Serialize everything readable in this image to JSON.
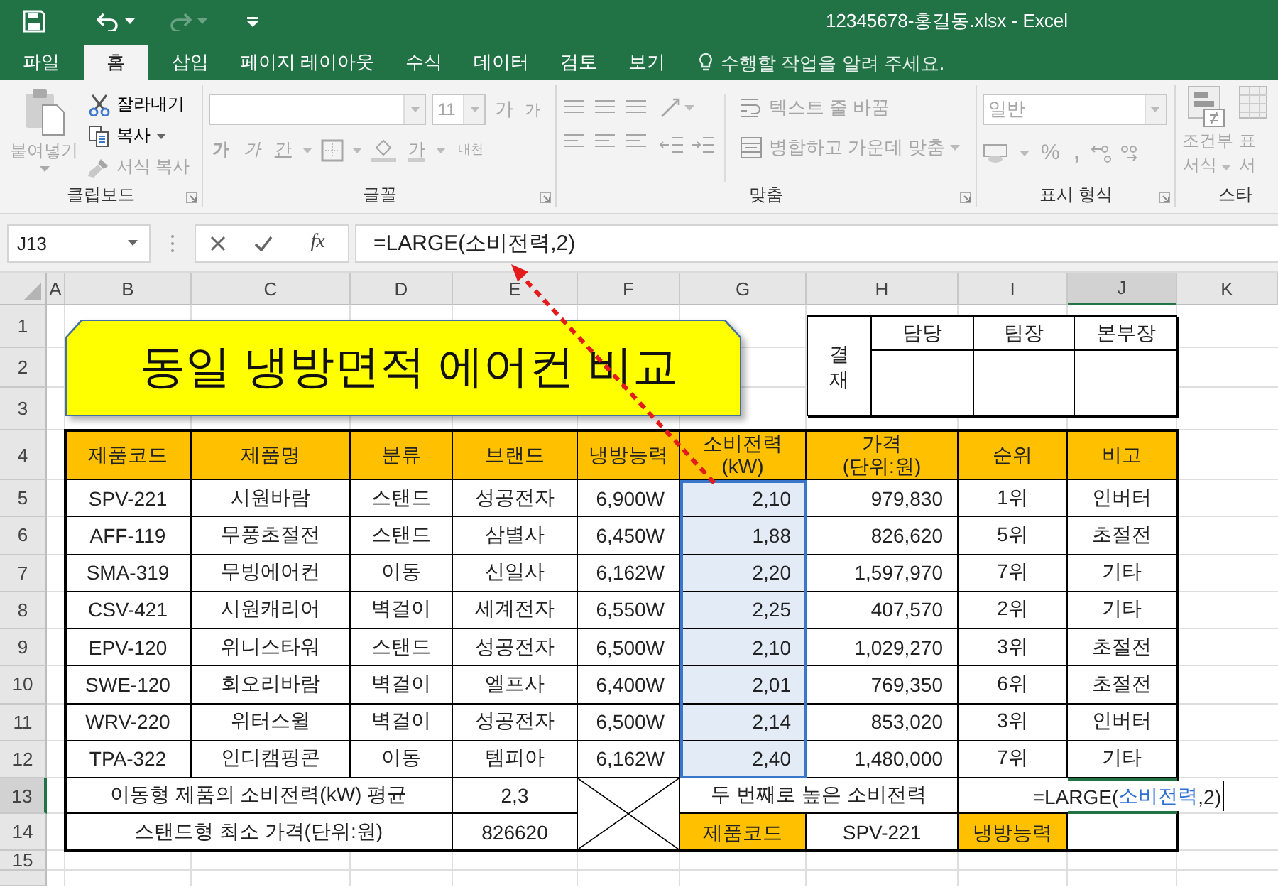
{
  "window": {
    "title": "12345678-홍길동.xlsx - Excel"
  },
  "tabs": [
    {
      "label": "파일",
      "selected": false
    },
    {
      "label": "홈",
      "selected": true
    },
    {
      "label": "삽입",
      "selected": false
    },
    {
      "label": "페이지 레이아웃",
      "selected": false
    },
    {
      "label": "수식",
      "selected": false
    },
    {
      "label": "데이터",
      "selected": false
    },
    {
      "label": "검토",
      "selected": false
    },
    {
      "label": "보기",
      "selected": false
    }
  ],
  "tell_me": {
    "placeholder": "수행할 작업을 알려 주세요."
  },
  "ribbon": {
    "clipboard": {
      "label": "클립보드",
      "paste": {
        "label": "붙여넣기",
        "disabled": true
      },
      "cut": {
        "label": "잘라내기",
        "disabled": false
      },
      "copy": {
        "label": "복사",
        "disabled": false
      },
      "format_painter": {
        "label": "서식 복사",
        "disabled": true
      }
    },
    "font": {
      "label": "글꼴",
      "disabled": true,
      "size": "11",
      "grow": "가",
      "shrink": "가",
      "bold": "가",
      "italic": "가",
      "underline": "간",
      "font_color": "가",
      "phonetic": "내천"
    },
    "alignment": {
      "label": "맞춤",
      "disabled": true,
      "wrap_text": "텍스트 줄 바꿈",
      "merge": "병합하고 가운데 맞춤"
    },
    "number": {
      "label": "표시 형식",
      "disabled": true,
      "format": "일반",
      "percent": "%",
      "comma": ","
    },
    "styles": {
      "label": "스타",
      "disabled": true,
      "conditional": [
        "조건부",
        "서식"
      ],
      "table": [
        "표",
        "서"
      ]
    }
  },
  "formula_bar": {
    "name_box": "J13",
    "function_label": "fx",
    "formula": "=LARGE(소비전력,2)"
  },
  "sheet": {
    "columns": [
      {
        "label": "A",
        "selected": false
      },
      {
        "label": "B",
        "selected": false
      },
      {
        "label": "C",
        "selected": false
      },
      {
        "label": "D",
        "selected": false
      },
      {
        "label": "E",
        "selected": false
      },
      {
        "label": "F",
        "selected": false
      },
      {
        "label": "G",
        "selected": false
      },
      {
        "label": "H",
        "selected": false
      },
      {
        "label": "I",
        "selected": false
      },
      {
        "label": "J",
        "selected": true
      },
      {
        "label": "K",
        "selected": false
      }
    ],
    "rows": [
      {
        "label": "1",
        "selected": false
      },
      {
        "label": "2",
        "selected": false
      },
      {
        "label": "3",
        "selected": false
      },
      {
        "label": "4",
        "selected": false
      },
      {
        "label": "5",
        "selected": false
      },
      {
        "label": "6",
        "selected": false
      },
      {
        "label": "7",
        "selected": false
      },
      {
        "label": "8",
        "selected": false
      },
      {
        "label": "9",
        "selected": false
      },
      {
        "label": "10",
        "selected": false
      },
      {
        "label": "11",
        "selected": false
      },
      {
        "label": "12",
        "selected": false
      },
      {
        "label": "13",
        "selected": true
      },
      {
        "label": "14",
        "selected": false
      },
      {
        "label": "15",
        "selected": false
      }
    ]
  },
  "title_banner": {
    "text": "동일 냉방면적 에어컨 비교"
  },
  "approval": {
    "label": "결재",
    "roles": [
      "담당",
      "팀장",
      "본부장"
    ]
  },
  "table": {
    "columns": [
      {
        "label": "제품코드",
        "highlighted": false
      },
      {
        "label": "제품명",
        "highlighted": false
      },
      {
        "label": "분류",
        "highlighted": false
      },
      {
        "label": "브랜드",
        "highlighted": false
      },
      {
        "label": "냉방능력",
        "highlighted": false
      },
      {
        "label": "소비전력\n(kW)",
        "highlighted": true
      },
      {
        "label": "가격\n(단위:원)",
        "highlighted": false
      },
      {
        "label": "순위",
        "highlighted": false
      },
      {
        "label": "비고",
        "highlighted": false
      }
    ],
    "rows": [
      [
        "SPV-221",
        "시원바람",
        "스탠드",
        "성공전자",
        "6,900W",
        "2,10",
        "979,830",
        "1위",
        "인버터"
      ],
      [
        "AFF-119",
        "무풍초절전",
        "스탠드",
        "삼별사",
        "6,450W",
        "1,88",
        "826,620",
        "5위",
        "초절전"
      ],
      [
        "SMA-319",
        "무빙에어컨",
        "이동",
        "신일사",
        "6,162W",
        "2,20",
        "1,597,970",
        "7위",
        "기타"
      ],
      [
        "CSV-421",
        "시원캐리어",
        "벽걸이",
        "세계전자",
        "6,550W",
        "2,25",
        "407,570",
        "2위",
        "기타"
      ],
      [
        "EPV-120",
        "위니스타워",
        "스탠드",
        "성공전자",
        "6,500W",
        "2,10",
        "1,029,270",
        "3위",
        "초절전"
      ],
      [
        "SWE-120",
        "회오리바람",
        "벽걸이",
        "엘프사",
        "6,400W",
        "2,01",
        "769,350",
        "6위",
        "초절전"
      ],
      [
        "WRV-220",
        "위터스윌",
        "벽걸이",
        "성공전자",
        "6,500W",
        "2,14",
        "853,020",
        "3위",
        "인버터"
      ],
      [
        "TPA-322",
        "인디캠핑콘",
        "이동",
        "템피아",
        "6,162W",
        "2,40",
        "1,480,000",
        "7위",
        "기타"
      ]
    ]
  },
  "summary": [
    {
      "label": "이동형 제품의 소비전력(kW) 평균",
      "value": "2,3"
    },
    {
      "label": "스탠드형 최소 가격(단위:원)",
      "value": "826620"
    }
  ],
  "query": {
    "label": "두 번째로 높은 소비전력",
    "formula_parts": [
      {
        "text": "=LARGE(",
        "kind": "plain"
      },
      {
        "text": "소비전력",
        "kind": "reference"
      },
      {
        "text": ",2)",
        "kind": "plain"
      }
    ],
    "lookup": [
      {
        "text": "제품코드",
        "kind": "header"
      },
      {
        "text": "SPV-221",
        "kind": "value"
      },
      {
        "text": "냉방능력",
        "kind": "header"
      }
    ]
  }
}
